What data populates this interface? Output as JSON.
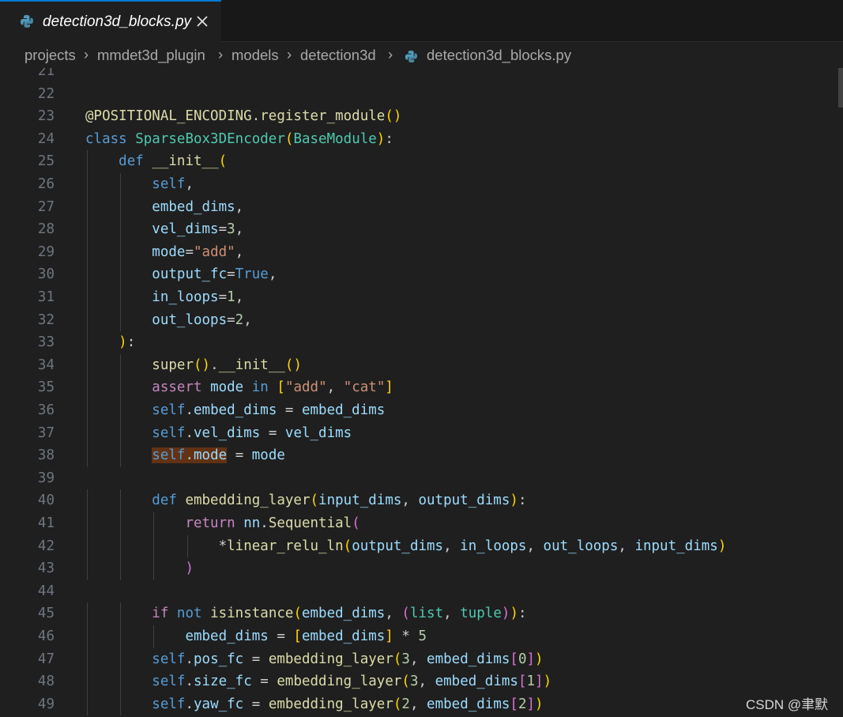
{
  "tab": {
    "filename": "detection3d_blocks.py",
    "close_glyph": "✕"
  },
  "breadcrumb": [
    "projects",
    "mmdet3d_plugin",
    "models",
    "detection3d",
    "detection3d_blocks.py"
  ],
  "breadcrumb_separator": "›",
  "editor": {
    "lines": [
      {
        "n": "21",
        "t": ""
      },
      {
        "n": "22",
        "t": ""
      },
      {
        "n": "23",
        "t": "@POSITIONAL_ENCODING.register_module()"
      },
      {
        "n": "24",
        "t": "class SparseBox3DEncoder(BaseModule):"
      },
      {
        "n": "25",
        "t": "    def __init__("
      },
      {
        "n": "26",
        "t": "        self,"
      },
      {
        "n": "27",
        "t": "        embed_dims,"
      },
      {
        "n": "28",
        "t": "        vel_dims=3,"
      },
      {
        "n": "29",
        "t": "        mode=\"add\","
      },
      {
        "n": "30",
        "t": "        output_fc=True,"
      },
      {
        "n": "31",
        "t": "        in_loops=1,"
      },
      {
        "n": "32",
        "t": "        out_loops=2,"
      },
      {
        "n": "33",
        "t": "    ):"
      },
      {
        "n": "34",
        "t": "        super().__init__()"
      },
      {
        "n": "35",
        "t": "        assert mode in [\"add\", \"cat\"]"
      },
      {
        "n": "36",
        "t": "        self.embed_dims = embed_dims"
      },
      {
        "n": "37",
        "t": "        self.vel_dims = vel_dims"
      },
      {
        "n": "38",
        "t": "        self.mode = mode"
      },
      {
        "n": "39",
        "t": ""
      },
      {
        "n": "40",
        "t": "        def embedding_layer(input_dims, output_dims):"
      },
      {
        "n": "41",
        "t": "            return nn.Sequential("
      },
      {
        "n": "42",
        "t": "                *linear_relu_ln(output_dims, in_loops, out_loops, input_dims)"
      },
      {
        "n": "43",
        "t": "            )"
      },
      {
        "n": "44",
        "t": ""
      },
      {
        "n": "45",
        "t": "        if not isinstance(embed_dims, (list, tuple)):"
      },
      {
        "n": "46",
        "t": "            embed_dims = [embed_dims] * 5"
      },
      {
        "n": "47",
        "t": "        self.pos_fc = embedding_layer(3, embed_dims[0])"
      },
      {
        "n": "48",
        "t": "        self.size_fc = embedding_layer(3, embed_dims[1])"
      },
      {
        "n": "49",
        "t": "        self.yaw_fc = embedding_layer(2, embed_dims[2])"
      }
    ],
    "highlighted_line": "38"
  },
  "watermark": "CSDN @聿默",
  "colors": {
    "background": "#1f1f1f",
    "tab_active_border": "#0078d4",
    "keyword": "#569cd6",
    "control_keyword": "#c586c0",
    "function": "#dcdcaa",
    "class": "#4ec9b0",
    "string": "#ce9178",
    "number": "#b5cea8",
    "variable": "#9cdcfe",
    "selection_highlight": "#613214"
  },
  "icons": {
    "file": "python-icon",
    "close": "close-icon"
  }
}
